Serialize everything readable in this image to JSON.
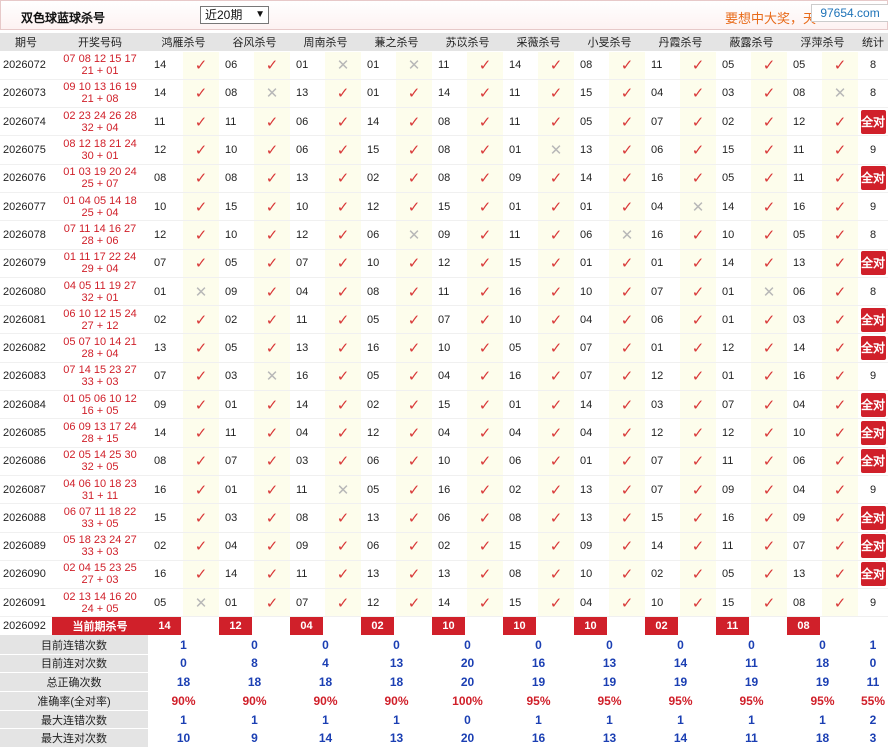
{
  "header": {
    "title": "双色球蓝球杀号",
    "select_value": "近20期",
    "slogan": "要想中大奖，天",
    "watermark": "97654.com"
  },
  "columns": {
    "period": "期号",
    "draw": "开奖号码",
    "experts": [
      "鸿雁杀号",
      "谷风杀号",
      "周南杀号",
      "蒹之杀号",
      "苏苡杀号",
      "采薇杀号",
      "小旻杀号",
      "丹霞杀号",
      "蔽露杀号",
      "浮萍杀号"
    ],
    "count": "统计"
  },
  "all_correct_label": "全对",
  "rows": [
    {
      "period": "2026072",
      "draw1": "07 08 12 15 17",
      "draw2": "21 + 01",
      "kills": [
        "14",
        "06",
        "01",
        "01",
        "11",
        "14",
        "08",
        "11",
        "05",
        "05"
      ],
      "hits": [
        1,
        1,
        0,
        0,
        1,
        1,
        1,
        1,
        1,
        1
      ],
      "count": "8"
    },
    {
      "period": "2026073",
      "draw1": "09 10 13 16 19",
      "draw2": "21 + 08",
      "kills": [
        "14",
        "08",
        "13",
        "01",
        "14",
        "11",
        "15",
        "04",
        "03",
        "08"
      ],
      "hits": [
        1,
        0,
        1,
        1,
        1,
        1,
        1,
        1,
        1,
        0
      ],
      "count": "8"
    },
    {
      "period": "2026074",
      "draw1": "02 23 24 26 28",
      "draw2": "32 + 04",
      "kills": [
        "11",
        "11",
        "06",
        "14",
        "08",
        "11",
        "05",
        "07",
        "02",
        "12"
      ],
      "hits": [
        1,
        1,
        1,
        1,
        1,
        1,
        1,
        1,
        1,
        1
      ],
      "count": "全对"
    },
    {
      "period": "2026075",
      "draw1": "08 12 18 21 24",
      "draw2": "30 + 01",
      "kills": [
        "12",
        "10",
        "06",
        "15",
        "08",
        "01",
        "13",
        "06",
        "15",
        "11"
      ],
      "hits": [
        1,
        1,
        1,
        1,
        1,
        0,
        1,
        1,
        1,
        1
      ],
      "count": "9"
    },
    {
      "period": "2026076",
      "draw1": "01 03 19 20 24",
      "draw2": "25 + 07",
      "kills": [
        "08",
        "08",
        "13",
        "02",
        "08",
        "09",
        "14",
        "16",
        "05",
        "11"
      ],
      "hits": [
        1,
        1,
        1,
        1,
        1,
        1,
        1,
        1,
        1,
        1
      ],
      "count": "全对"
    },
    {
      "period": "2026077",
      "draw1": "01 04 05 14 18",
      "draw2": "25 + 04",
      "kills": [
        "10",
        "15",
        "10",
        "12",
        "15",
        "01",
        "01",
        "04",
        "14",
        "16"
      ],
      "hits": [
        1,
        1,
        1,
        1,
        1,
        1,
        1,
        0,
        1,
        1
      ],
      "count": "9"
    },
    {
      "period": "2026078",
      "draw1": "07 11 14 16 27",
      "draw2": "28 + 06",
      "kills": [
        "12",
        "10",
        "12",
        "06",
        "09",
        "11",
        "06",
        "16",
        "10",
        "05"
      ],
      "hits": [
        1,
        1,
        1,
        0,
        1,
        1,
        0,
        1,
        1,
        1
      ],
      "count": "8"
    },
    {
      "period": "2026079",
      "draw1": "01 11 17 22 24",
      "draw2": "29 + 04",
      "kills": [
        "07",
        "05",
        "07",
        "10",
        "12",
        "15",
        "01",
        "01",
        "14",
        "13"
      ],
      "hits": [
        1,
        1,
        1,
        1,
        1,
        1,
        1,
        1,
        1,
        1
      ],
      "count": "全对"
    },
    {
      "period": "2026080",
      "draw1": "04 05 11 19 27",
      "draw2": "32 + 01",
      "kills": [
        "01",
        "09",
        "04",
        "08",
        "11",
        "16",
        "10",
        "07",
        "01",
        "06"
      ],
      "hits": [
        0,
        1,
        1,
        1,
        1,
        1,
        1,
        1,
        0,
        1
      ],
      "count": "8"
    },
    {
      "period": "2026081",
      "draw1": "06 10 12 15 24",
      "draw2": "27 + 12",
      "kills": [
        "02",
        "02",
        "11",
        "05",
        "07",
        "10",
        "04",
        "06",
        "01",
        "03"
      ],
      "hits": [
        1,
        1,
        1,
        1,
        1,
        1,
        1,
        1,
        1,
        1
      ],
      "count": "全对"
    },
    {
      "period": "2026082",
      "draw1": "05 07 10 14 21",
      "draw2": "28 + 04",
      "kills": [
        "13",
        "05",
        "13",
        "16",
        "10",
        "05",
        "07",
        "01",
        "12",
        "14"
      ],
      "hits": [
        1,
        1,
        1,
        1,
        1,
        1,
        1,
        1,
        1,
        1
      ],
      "count": "全对"
    },
    {
      "period": "2026083",
      "draw1": "07 14 15 23 27",
      "draw2": "33 + 03",
      "kills": [
        "07",
        "03",
        "16",
        "05",
        "04",
        "16",
        "07",
        "12",
        "01",
        "16"
      ],
      "hits": [
        1,
        0,
        1,
        1,
        1,
        1,
        1,
        1,
        1,
        1
      ],
      "count": "9"
    },
    {
      "period": "2026084",
      "draw1": "01 05 06 10 12",
      "draw2": "16 + 05",
      "kills": [
        "09",
        "01",
        "14",
        "02",
        "15",
        "01",
        "14",
        "03",
        "07",
        "04"
      ],
      "hits": [
        1,
        1,
        1,
        1,
        1,
        1,
        1,
        1,
        1,
        1
      ],
      "count": "全对"
    },
    {
      "period": "2026085",
      "draw1": "06 09 13 17 24",
      "draw2": "28 + 15",
      "kills": [
        "14",
        "11",
        "04",
        "12",
        "04",
        "04",
        "04",
        "12",
        "12",
        "10"
      ],
      "hits": [
        1,
        1,
        1,
        1,
        1,
        1,
        1,
        1,
        1,
        1
      ],
      "count": "全对"
    },
    {
      "period": "2026086",
      "draw1": "02 05 14 25 30",
      "draw2": "32 + 05",
      "kills": [
        "08",
        "07",
        "03",
        "06",
        "10",
        "06",
        "01",
        "07",
        "11",
        "06"
      ],
      "hits": [
        1,
        1,
        1,
        1,
        1,
        1,
        1,
        1,
        1,
        1
      ],
      "count": "全对"
    },
    {
      "period": "2026087",
      "draw1": "04 06 10 18 23",
      "draw2": "31 + 11",
      "kills": [
        "16",
        "01",
        "11",
        "05",
        "16",
        "02",
        "13",
        "07",
        "09",
        "04"
      ],
      "hits": [
        1,
        1,
        0,
        1,
        1,
        1,
        1,
        1,
        1,
        1
      ],
      "count": "9"
    },
    {
      "period": "2026088",
      "draw1": "06 07 11 18 22",
      "draw2": "33 + 05",
      "kills": [
        "15",
        "03",
        "08",
        "13",
        "06",
        "08",
        "13",
        "15",
        "16",
        "09"
      ],
      "hits": [
        1,
        1,
        1,
        1,
        1,
        1,
        1,
        1,
        1,
        1
      ],
      "count": "全对"
    },
    {
      "period": "2026089",
      "draw1": "05 18 23 24 27",
      "draw2": "33 + 03",
      "kills": [
        "02",
        "04",
        "09",
        "06",
        "02",
        "15",
        "09",
        "14",
        "11",
        "07"
      ],
      "hits": [
        1,
        1,
        1,
        1,
        1,
        1,
        1,
        1,
        1,
        1
      ],
      "count": "全对"
    },
    {
      "period": "2026090",
      "draw1": "02 04 15 23 25",
      "draw2": "27 + 03",
      "kills": [
        "16",
        "14",
        "11",
        "13",
        "13",
        "08",
        "10",
        "02",
        "05",
        "13"
      ],
      "hits": [
        1,
        1,
        1,
        1,
        1,
        1,
        1,
        1,
        1,
        1
      ],
      "count": "全对"
    },
    {
      "period": "2026091",
      "draw1": "02 13 14 16 20",
      "draw2": "24 + 05",
      "kills": [
        "05",
        "01",
        "07",
        "12",
        "14",
        "15",
        "04",
        "10",
        "15",
        "08"
      ],
      "hits": [
        0,
        1,
        1,
        1,
        1,
        1,
        1,
        1,
        1,
        1
      ],
      "count": "9"
    }
  ],
  "current": {
    "period": "2026092",
    "label": "当前期杀号",
    "kills": [
      "14",
      "12",
      "04",
      "02",
      "10",
      "10",
      "10",
      "02",
      "11",
      "08"
    ]
  },
  "stats": [
    {
      "label": "目前连错次数",
      "values": [
        "1",
        "0",
        "0",
        "0",
        "0",
        "0",
        "0",
        "0",
        "0",
        "0"
      ],
      "count": "1",
      "red": false
    },
    {
      "label": "目前连对次数",
      "values": [
        "0",
        "8",
        "4",
        "13",
        "20",
        "16",
        "13",
        "14",
        "11",
        "18"
      ],
      "count": "0",
      "red": false
    },
    {
      "label": "总正确次数",
      "values": [
        "18",
        "18",
        "18",
        "18",
        "20",
        "19",
        "19",
        "19",
        "19",
        "19"
      ],
      "count": "11",
      "red": false
    },
    {
      "label": "准确率(全对率)",
      "values": [
        "90%",
        "90%",
        "90%",
        "90%",
        "100%",
        "95%",
        "95%",
        "95%",
        "95%",
        "95%"
      ],
      "count": "55%",
      "red": true
    },
    {
      "label": "最大连错次数",
      "values": [
        "1",
        "1",
        "1",
        "1",
        "0",
        "1",
        "1",
        "1",
        "1",
        "1"
      ],
      "count": "2",
      "red": false
    },
    {
      "label": "最大连对次数",
      "values": [
        "10",
        "9",
        "14",
        "13",
        "20",
        "16",
        "13",
        "14",
        "11",
        "18"
      ],
      "count": "3",
      "red": false
    }
  ]
}
